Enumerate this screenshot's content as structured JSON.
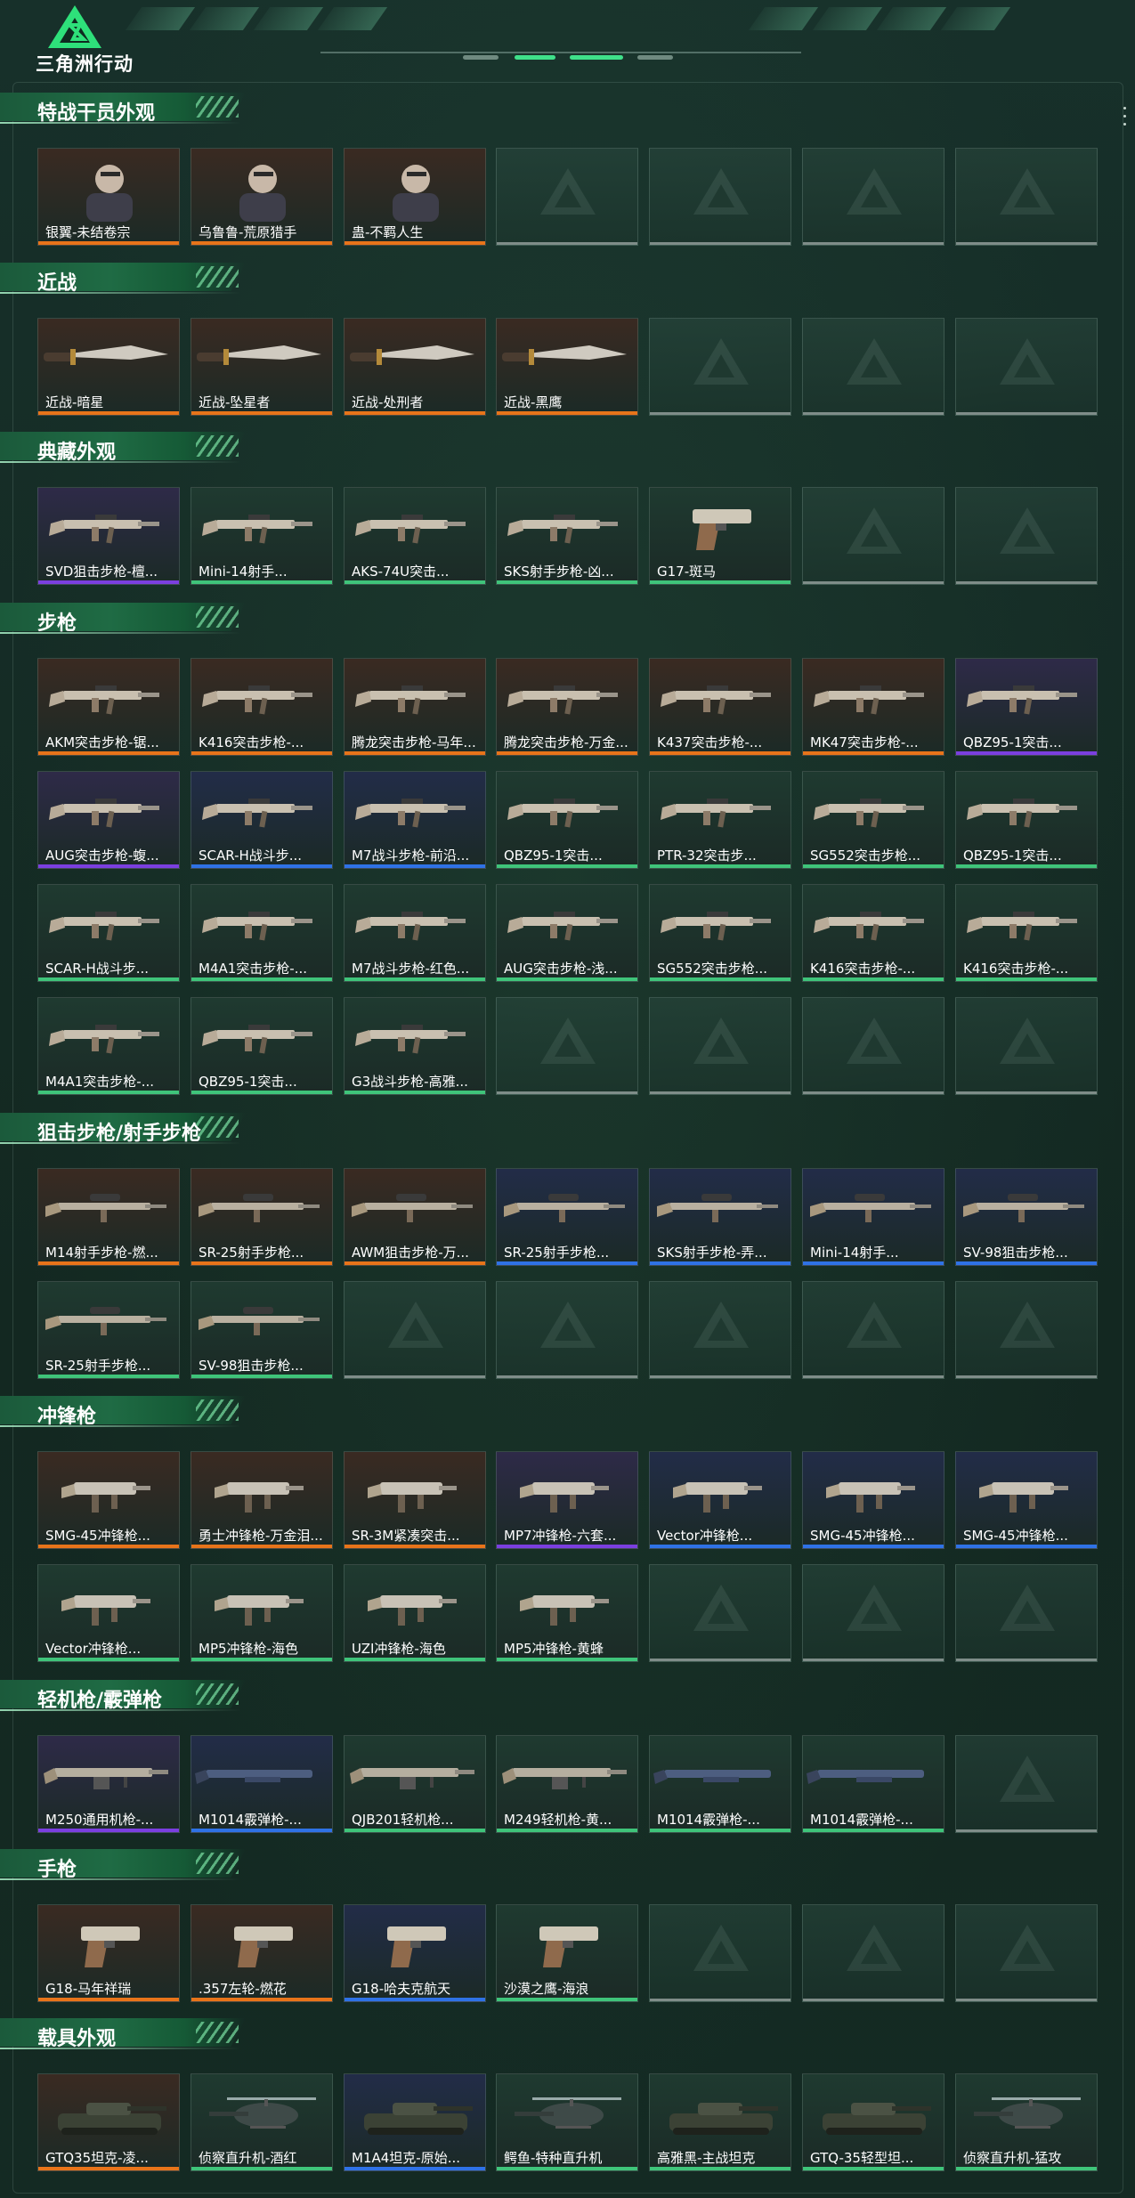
{
  "header": {
    "logo_text": "三角洲行动",
    "colors": {
      "accent": "#3fe08a",
      "header_bg": "#1a3028"
    }
  },
  "rarity_colors": {
    "orange": "#e8741a",
    "purple": "#7b3fe0",
    "blue": "#2f72e6",
    "green": "#3fc47a",
    "grey": "#7f8d89"
  },
  "thumb_colors": {
    "orange": "#3a2a22",
    "purple": "#2e2a48",
    "blue": "#222c48",
    "green": "#1f3a30"
  },
  "sections": [
    {
      "title": "特战干员外观",
      "items": [
        {
          "label": "银翼-未结卷宗",
          "rarity": "orange",
          "icon": "operator-portrait"
        },
        {
          "label": "乌鲁鲁-荒原猎手",
          "rarity": "orange",
          "icon": "operator-portrait"
        },
        {
          "label": "蛊-不羁人生",
          "rarity": "orange",
          "icon": "operator-portrait"
        }
      ]
    },
    {
      "title": "近战",
      "items": [
        {
          "label": "近战-暗星",
          "rarity": "orange",
          "icon": "knife"
        },
        {
          "label": "近战-坠星者",
          "rarity": "orange",
          "icon": "knife"
        },
        {
          "label": "近战-处刑者",
          "rarity": "orange",
          "icon": "knife"
        },
        {
          "label": "近战-黑鹰",
          "rarity": "orange",
          "icon": "knife"
        }
      ]
    },
    {
      "title": "典藏外观",
      "items": [
        {
          "label": "SVD狙击步枪-檀...",
          "rarity": "purple",
          "icon": "rifle"
        },
        {
          "label": "Mini-14射手...",
          "rarity": "green",
          "icon": "rifle"
        },
        {
          "label": "AKS-74U突击...",
          "rarity": "green",
          "icon": "rifle"
        },
        {
          "label": "SKS射手步枪-凶...",
          "rarity": "green",
          "icon": "rifle"
        },
        {
          "label": "G17-斑马",
          "rarity": "green",
          "icon": "pistol"
        }
      ]
    },
    {
      "title": "步枪",
      "items": [
        {
          "label": "AKM突击步枪-锯...",
          "rarity": "orange",
          "icon": "rifle"
        },
        {
          "label": "K416突击步枪-...",
          "rarity": "orange",
          "icon": "rifle"
        },
        {
          "label": "腾龙突击步枪-马年...",
          "rarity": "orange",
          "icon": "rifle"
        },
        {
          "label": "腾龙突击步枪-万金...",
          "rarity": "orange",
          "icon": "rifle"
        },
        {
          "label": "K437突击步枪-...",
          "rarity": "orange",
          "icon": "rifle"
        },
        {
          "label": "MK47突击步枪-...",
          "rarity": "orange",
          "icon": "rifle"
        },
        {
          "label": "QBZ95-1突击...",
          "rarity": "purple",
          "icon": "rifle"
        },
        {
          "label": "AUG突击步枪-蝮...",
          "rarity": "purple",
          "icon": "rifle"
        },
        {
          "label": "SCAR-H战斗步...",
          "rarity": "blue",
          "icon": "rifle"
        },
        {
          "label": "M7战斗步枪-前沿...",
          "rarity": "blue",
          "icon": "rifle"
        },
        {
          "label": "QBZ95-1突击...",
          "rarity": "green",
          "icon": "rifle"
        },
        {
          "label": "PTR-32突击步...",
          "rarity": "green",
          "icon": "rifle"
        },
        {
          "label": "SG552突击步枪...",
          "rarity": "green",
          "icon": "rifle"
        },
        {
          "label": "QBZ95-1突击...",
          "rarity": "green",
          "icon": "rifle"
        },
        {
          "label": "SCAR-H战斗步...",
          "rarity": "green",
          "icon": "rifle"
        },
        {
          "label": "M4A1突击步枪-...",
          "rarity": "green",
          "icon": "rifle"
        },
        {
          "label": "M7战斗步枪-红色...",
          "rarity": "green",
          "icon": "rifle"
        },
        {
          "label": "AUG突击步枪-浅...",
          "rarity": "green",
          "icon": "rifle"
        },
        {
          "label": "SG552突击步枪...",
          "rarity": "green",
          "icon": "rifle"
        },
        {
          "label": "K416突击步枪-...",
          "rarity": "green",
          "icon": "rifle"
        },
        {
          "label": "K416突击步枪-...",
          "rarity": "green",
          "icon": "rifle"
        },
        {
          "label": "M4A1突击步枪-...",
          "rarity": "green",
          "icon": "rifle"
        },
        {
          "label": "QBZ95-1突击...",
          "rarity": "green",
          "icon": "rifle"
        },
        {
          "label": "G3战斗步枪-高雅...",
          "rarity": "green",
          "icon": "rifle"
        }
      ]
    },
    {
      "title": "狙击步枪/射手步枪",
      "items": [
        {
          "label": "M14射手步枪-燃...",
          "rarity": "orange",
          "icon": "sniper"
        },
        {
          "label": "SR-25射手步枪...",
          "rarity": "orange",
          "icon": "sniper"
        },
        {
          "label": "AWM狙击步枪-万...",
          "rarity": "orange",
          "icon": "sniper"
        },
        {
          "label": "SR-25射手步枪...",
          "rarity": "blue",
          "icon": "sniper"
        },
        {
          "label": "SKS射手步枪-弄...",
          "rarity": "blue",
          "icon": "sniper"
        },
        {
          "label": "Mini-14射手...",
          "rarity": "blue",
          "icon": "sniper"
        },
        {
          "label": "SV-98狙击步枪...",
          "rarity": "blue",
          "icon": "sniper"
        },
        {
          "label": "SR-25射手步枪...",
          "rarity": "green",
          "icon": "sniper"
        },
        {
          "label": "SV-98狙击步枪...",
          "rarity": "green",
          "icon": "sniper"
        }
      ]
    },
    {
      "title": "冲锋枪",
      "items": [
        {
          "label": "SMG-45冲锋枪...",
          "rarity": "orange",
          "icon": "smg"
        },
        {
          "label": "勇士冲锋枪-万金泪...",
          "rarity": "orange",
          "icon": "smg"
        },
        {
          "label": "SR-3M紧凑突击...",
          "rarity": "orange",
          "icon": "smg"
        },
        {
          "label": "MP7冲锋枪-六套...",
          "rarity": "purple",
          "icon": "smg"
        },
        {
          "label": "Vector冲锋枪...",
          "rarity": "blue",
          "icon": "smg"
        },
        {
          "label": "SMG-45冲锋枪...",
          "rarity": "blue",
          "icon": "smg"
        },
        {
          "label": "SMG-45冲锋枪...",
          "rarity": "blue",
          "icon": "smg"
        },
        {
          "label": "Vector冲锋枪...",
          "rarity": "green",
          "icon": "smg"
        },
        {
          "label": "MP5冲锋枪-海色",
          "rarity": "green",
          "icon": "smg"
        },
        {
          "label": "UZI冲锋枪-海色",
          "rarity": "green",
          "icon": "smg"
        },
        {
          "label": "MP5冲锋枪-黄蜂",
          "rarity": "green",
          "icon": "smg"
        }
      ]
    },
    {
      "title": "轻机枪/霰弹枪",
      "items": [
        {
          "label": "M250通用机枪-...",
          "rarity": "purple",
          "icon": "machinegun"
        },
        {
          "label": "M1014霰弹枪-...",
          "rarity": "blue",
          "icon": "shotgun"
        },
        {
          "label": "QJB201轻机枪...",
          "rarity": "green",
          "icon": "machinegun"
        },
        {
          "label": "M249轻机枪-黄...",
          "rarity": "green",
          "icon": "machinegun"
        },
        {
          "label": "M1014霰弹枪-...",
          "rarity": "green",
          "icon": "shotgun"
        },
        {
          "label": "M1014霰弹枪-...",
          "rarity": "green",
          "icon": "shotgun"
        }
      ]
    },
    {
      "title": "手枪",
      "items": [
        {
          "label": "G18-马年祥瑞",
          "rarity": "orange",
          "icon": "pistol"
        },
        {
          "label": ".357左轮-燃花",
          "rarity": "orange",
          "icon": "pistol"
        },
        {
          "label": "G18-哈夫克航天",
          "rarity": "blue",
          "icon": "pistol"
        },
        {
          "label": "沙漠之鹰-海浪",
          "rarity": "green",
          "icon": "pistol"
        }
      ]
    },
    {
      "title": "载具外观",
      "items": [
        {
          "label": "GTQ35坦克-凌...",
          "rarity": "orange",
          "icon": "tank"
        },
        {
          "label": "侦察直升机-酒红",
          "rarity": "green",
          "icon": "helicopter"
        },
        {
          "label": "M1A4坦克-原始...",
          "rarity": "blue",
          "icon": "tank"
        },
        {
          "label": "鳄鱼-特种直升机",
          "rarity": "green",
          "icon": "helicopter"
        },
        {
          "label": "高雅黑-主战坦克",
          "rarity": "green",
          "icon": "tank"
        },
        {
          "label": "GTQ-35轻型坦...",
          "rarity": "green",
          "icon": "tank"
        },
        {
          "label": "侦察直升机-猛攻",
          "rarity": "green",
          "icon": "helicopter"
        }
      ]
    }
  ]
}
